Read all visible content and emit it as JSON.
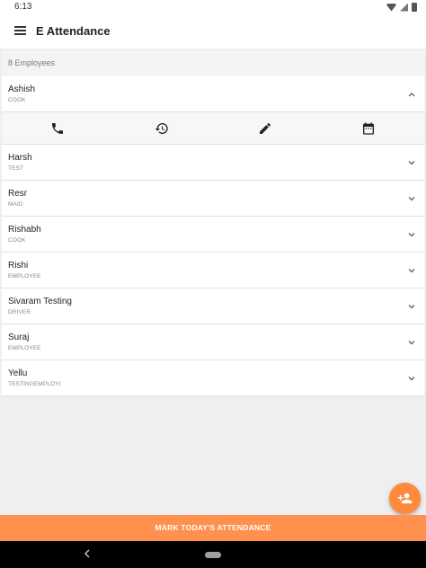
{
  "status_bar": {
    "time": "6:13"
  },
  "app_bar": {
    "title": "E Attendance"
  },
  "list": {
    "count_label": "8 Employees",
    "employees": [
      {
        "name": "Ashish",
        "role": "COOK",
        "expanded": true
      },
      {
        "name": "Harsh",
        "role": "TEST"
      },
      {
        "name": "Resr",
        "role": "MAID"
      },
      {
        "name": "Rishabh",
        "role": "COOK"
      },
      {
        "name": "Rishi",
        "role": "EMPLOYEE"
      },
      {
        "name": "Sivaram Testing",
        "role": "DRIVER"
      },
      {
        "name": "Suraj",
        "role": "EMPLOYEE"
      },
      {
        "name": "Yellu",
        "role": "TESTINGEMPLOYI"
      }
    ],
    "actions": [
      "phone-icon",
      "history-icon",
      "edit-icon",
      "calendar-icon"
    ]
  },
  "fab": {
    "icon": "add-person-icon"
  },
  "bottom_button": {
    "label": "MARK TODAY'S ATTENDANCE"
  },
  "colors": {
    "accent": "#ff904d",
    "fab": "#ff8a3d"
  }
}
